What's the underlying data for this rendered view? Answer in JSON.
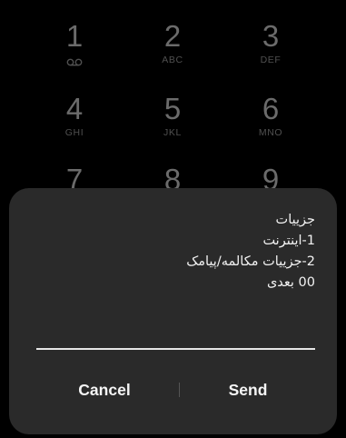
{
  "keypad": {
    "keys": [
      {
        "digit": "1",
        "letters": "",
        "icon": "voicemail-icon"
      },
      {
        "digit": "2",
        "letters": "ABC"
      },
      {
        "digit": "3",
        "letters": "DEF"
      },
      {
        "digit": "4",
        "letters": "GHI"
      },
      {
        "digit": "5",
        "letters": "JKL"
      },
      {
        "digit": "6",
        "letters": "MNO"
      },
      {
        "digit": "7",
        "letters": ""
      },
      {
        "digit": "8",
        "letters": ""
      },
      {
        "digit": "9",
        "letters": ""
      }
    ]
  },
  "dialog": {
    "message_lines": [
      "جزییات",
      "1-اینترنت",
      "2-جزییات مکالمه/پیامک",
      "00 بعدی"
    ],
    "input": {
      "value": "",
      "placeholder": ""
    },
    "cancel_label": "Cancel",
    "send_label": "Send"
  },
  "colors": {
    "background": "#000000",
    "dialog_background": "#2a2a2a",
    "text": "#f2f2f2",
    "dimmed_key": "#6b6b6b"
  }
}
